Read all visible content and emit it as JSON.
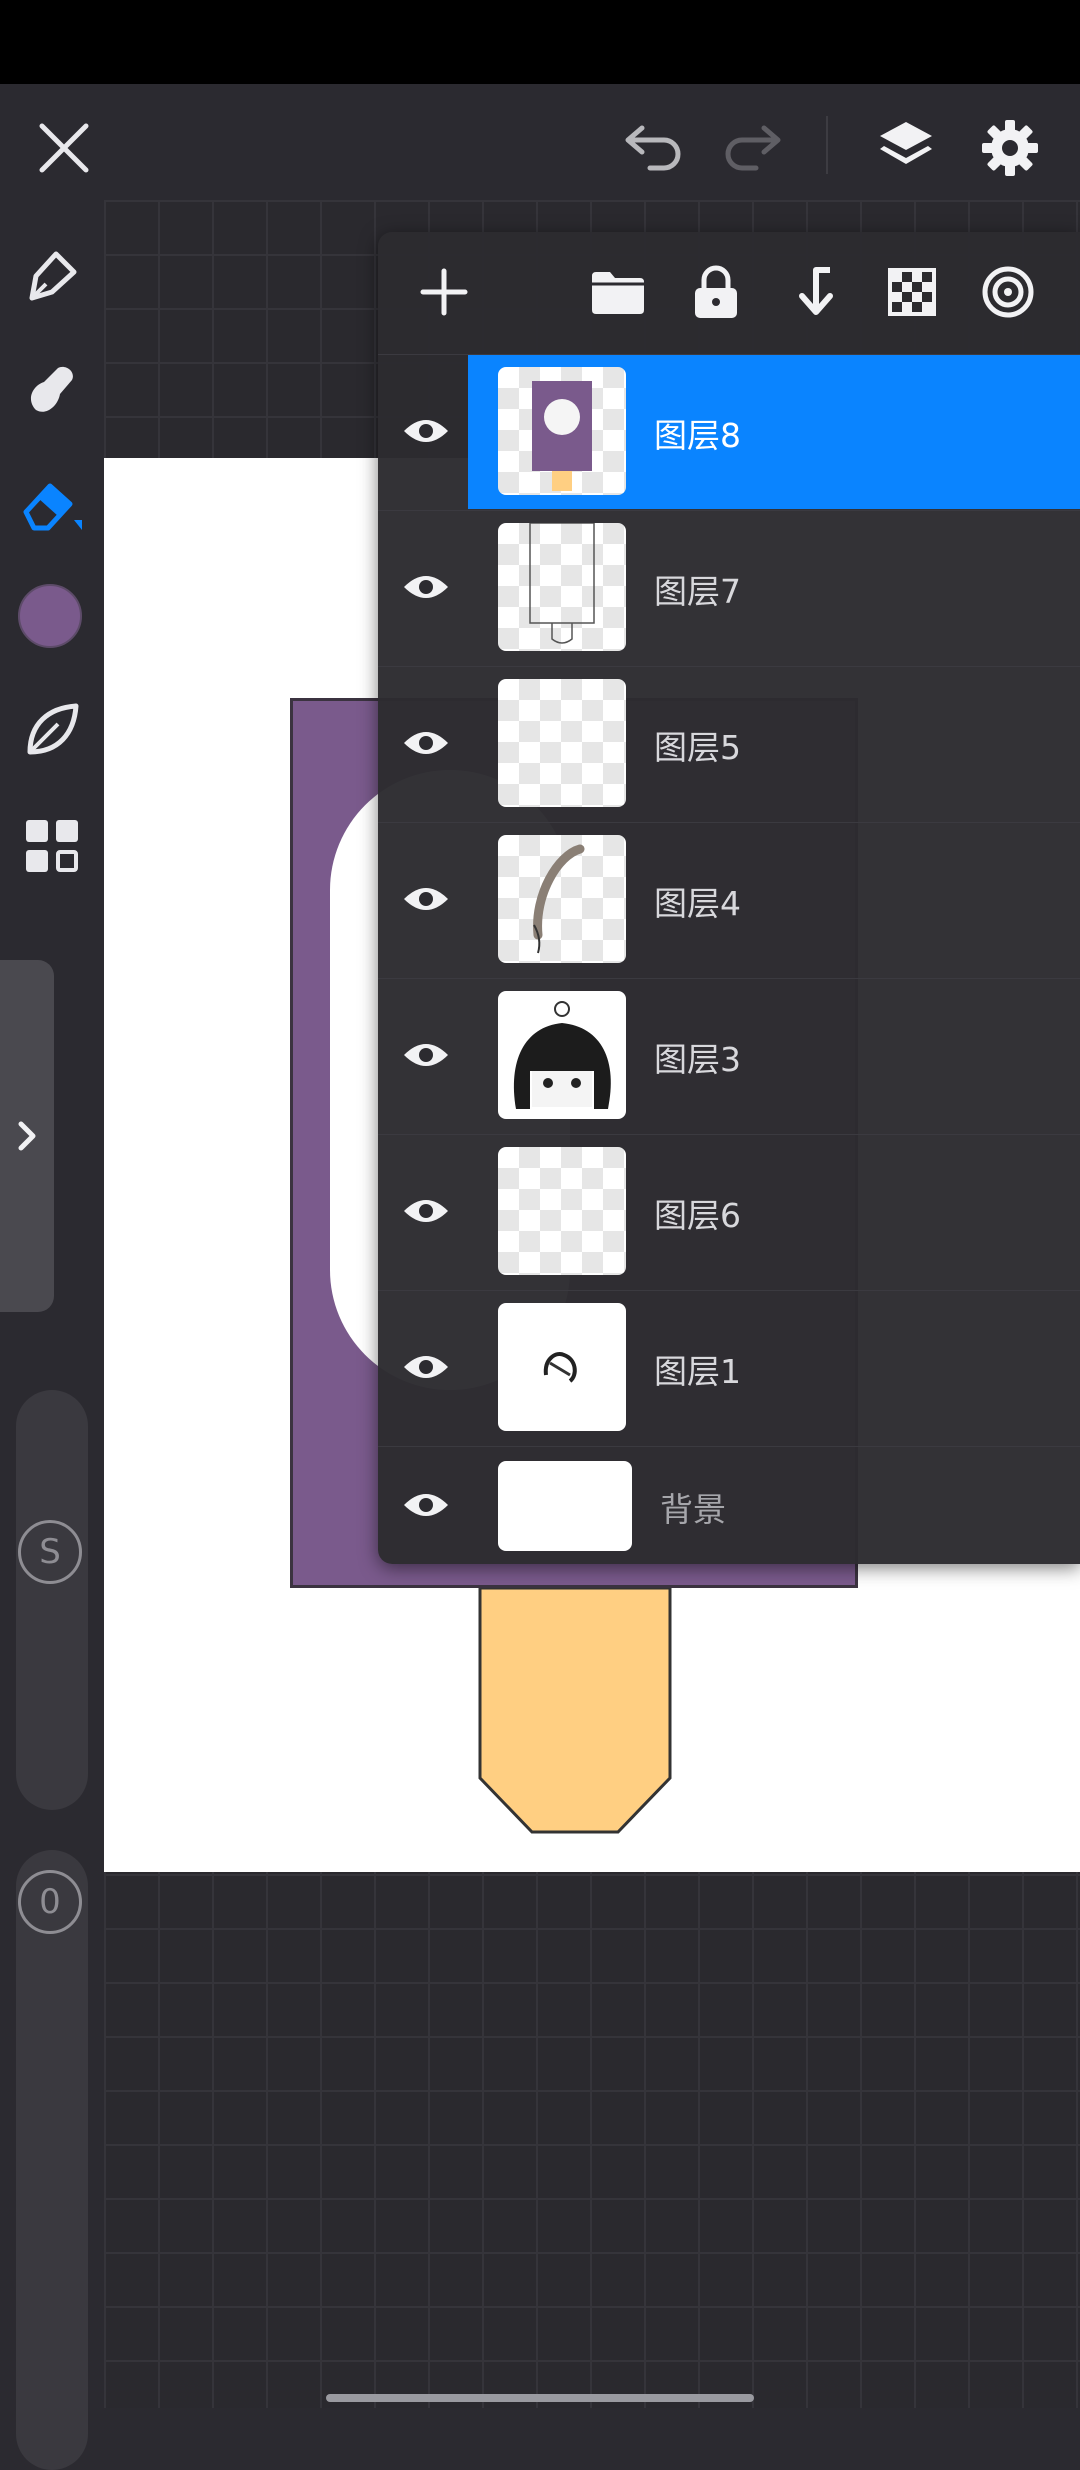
{
  "colors": {
    "accent": "#0a84ff",
    "current_color": "#7a5a8c",
    "popsicle_stick": "#ffcf82",
    "toolbar_bg": "#2b2a30"
  },
  "toolbar": {
    "close_icon": "close-icon",
    "undo_icon": "undo-icon",
    "redo_icon": "redo-icon",
    "layers_icon": "layers-icon",
    "settings_icon": "gear-icon"
  },
  "left_tools": {
    "items": [
      "pen-icon",
      "smudge-icon",
      "eraser-icon",
      "color-swatch",
      "leaf-icon",
      "grid-icon"
    ],
    "size_label": "S",
    "opacity_label": "0"
  },
  "layers_panel": {
    "header_icons": [
      "plus-icon",
      "folder-icon",
      "lock-icon",
      "merge-down-icon",
      "checker-icon",
      "target-icon"
    ],
    "layers": [
      {
        "name": "图层8",
        "visible": true,
        "selected": true
      },
      {
        "name": "图层7",
        "visible": true,
        "selected": false
      },
      {
        "name": "图层5",
        "visible": true,
        "selected": false
      },
      {
        "name": "图层4",
        "visible": true,
        "selected": false
      },
      {
        "name": "图层3",
        "visible": true,
        "selected": false
      },
      {
        "name": "图层6",
        "visible": true,
        "selected": false
      },
      {
        "name": "图层1",
        "visible": true,
        "selected": false
      },
      {
        "name": "背景",
        "visible": true,
        "selected": false
      }
    ]
  }
}
